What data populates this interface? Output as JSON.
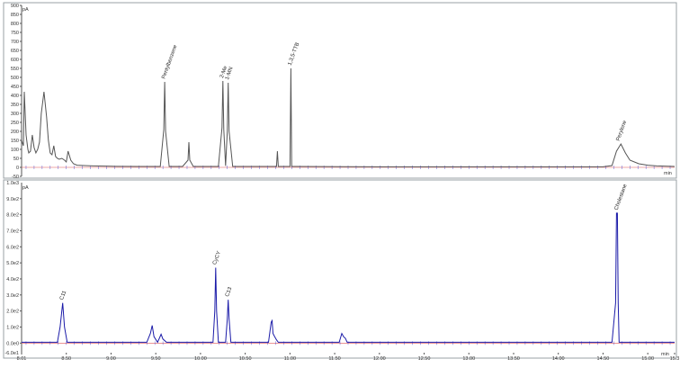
{
  "chart_data": [
    {
      "type": "line",
      "ylabel": "pA",
      "xlabel": "min",
      "xlim": [
        8.0,
        15.3
      ],
      "ylim": [
        -50,
        900
      ],
      "yticks": [
        -50,
        0,
        50,
        100,
        150,
        200,
        250,
        300,
        350,
        400,
        450,
        500,
        550,
        600,
        650,
        700,
        750,
        800,
        850,
        900
      ],
      "ytick_labels": [
        "-50",
        "0",
        "50",
        "100",
        "150",
        "200",
        "250",
        "300",
        "350",
        "400",
        "450",
        "500",
        "550",
        "600",
        "650",
        "700",
        "750",
        "800",
        "850",
        "900"
      ],
      "series": [
        {
          "color": "#555555",
          "x": [
            8.0,
            8.02,
            8.03,
            8.05,
            8.07,
            8.08,
            8.1,
            8.12,
            8.14,
            8.16,
            8.18,
            8.2,
            8.22,
            8.25,
            8.28,
            8.3,
            8.32,
            8.34,
            8.36,
            8.38,
            8.4,
            8.42,
            8.45,
            8.48,
            8.5,
            8.52,
            8.55,
            8.58,
            8.62,
            8.7,
            8.8,
            9.0,
            9.3,
            9.55,
            9.59,
            9.6,
            9.61,
            9.65,
            9.8,
            9.86,
            9.87,
            9.88,
            9.92,
            10.2,
            10.24,
            10.25,
            10.26,
            10.28,
            10.3,
            10.31,
            10.32,
            10.36,
            10.7,
            10.85,
            10.86,
            10.87,
            10.95,
            11.0,
            11.01,
            11.02,
            11.06,
            12.0,
            13.0,
            14.0,
            14.5,
            14.6,
            14.65,
            14.7,
            14.75,
            14.8,
            14.9,
            15.0,
            15.1,
            15.3
          ],
          "values": [
            150,
            120,
            420,
            180,
            100,
            80,
            90,
            180,
            110,
            80,
            100,
            140,
            300,
            420,
            280,
            150,
            80,
            70,
            120,
            60,
            50,
            45,
            50,
            40,
            30,
            90,
            40,
            20,
            12,
            10,
            8,
            6,
            5,
            5,
            210,
            475,
            200,
            5,
            5,
            40,
            140,
            40,
            5,
            5,
            220,
            480,
            210,
            8,
            200,
            470,
            200,
            5,
            5,
            5,
            90,
            5,
            5,
            5,
            550,
            5,
            5,
            3,
            3,
            3,
            3,
            10,
            90,
            130,
            80,
            40,
            20,
            12,
            8,
            5
          ],
          "peaks": [
            {
              "x": 9.6,
              "label": "Pentylbenzene"
            },
            {
              "x": 10.25,
              "label": "2-Me"
            },
            {
              "x": 10.31,
              "label": "1-MN"
            },
            {
              "x": 11.01,
              "label": "1,3,5-TTB"
            },
            {
              "x": 14.68,
              "label": "Perylene"
            }
          ]
        }
      ]
    },
    {
      "type": "line",
      "ylabel": "pA",
      "xlabel": "min",
      "xlim": [
        8.0,
        15.3
      ],
      "ylim": [
        -60,
        1000
      ],
      "yticks": [
        0,
        100,
        200,
        300,
        400,
        500,
        600,
        700,
        800,
        900
      ],
      "ytick_labels": [
        "0.0e0",
        "1.0e2",
        "2.0e2",
        "3.0e2",
        "4.0e2",
        "5.0e2",
        "6.0e2",
        "7.0e2",
        "8.0e2",
        "9.0e2"
      ],
      "extra_ytick_labels": [
        {
          "y": 1000,
          "label": "1.0e3"
        },
        {
          "y": -60,
          "label": "-6.0e1"
        }
      ],
      "xticks": [
        8.0,
        8.5,
        9.0,
        9.5,
        10.0,
        10.5,
        11.0,
        11.5,
        12.0,
        12.5,
        13.0,
        13.5,
        14.0,
        14.5,
        15.0,
        15.3
      ],
      "xtick_labels": [
        "8.01",
        "8.50",
        "9.00",
        "9.50",
        "10.00",
        "10.50",
        "11.00",
        "11.50",
        "12.00",
        "12.50",
        "13.00",
        "13.50",
        "14.00",
        "14.50",
        "15.00",
        "15.3"
      ],
      "series": [
        {
          "color": "#1a1aa8",
          "x": [
            8.0,
            8.4,
            8.43,
            8.46,
            8.48,
            8.51,
            8.55,
            9.4,
            9.44,
            9.46,
            9.48,
            9.52,
            9.56,
            9.58,
            9.62,
            10.14,
            10.16,
            10.17,
            10.18,
            10.2,
            10.28,
            10.3,
            10.31,
            10.32,
            10.34,
            10.76,
            10.79,
            10.8,
            10.81,
            10.83,
            10.85,
            10.87,
            11.55,
            11.58,
            11.6,
            11.62,
            11.64,
            12.0,
            13.0,
            14.0,
            14.6,
            14.64,
            14.65,
            14.66,
            14.67,
            14.68,
            14.72,
            15.0,
            15.3
          ],
          "values": [
            5,
            5,
            100,
            250,
            100,
            5,
            5,
            5,
            60,
            110,
            40,
            5,
            55,
            25,
            5,
            5,
            200,
            470,
            200,
            5,
            5,
            150,
            270,
            150,
            5,
            5,
            130,
            140,
            60,
            40,
            20,
            5,
            5,
            60,
            40,
            30,
            5,
            5,
            5,
            5,
            5,
            250,
            810,
            810,
            250,
            5,
            5,
            5,
            5
          ],
          "peaks": [
            {
              "x": 8.46,
              "label": "C11"
            },
            {
              "x": 10.17,
              "label": "CyCY"
            },
            {
              "x": 10.31,
              "label": "C13"
            },
            {
              "x": 14.66,
              "label": "Cholestane"
            }
          ]
        }
      ]
    }
  ]
}
